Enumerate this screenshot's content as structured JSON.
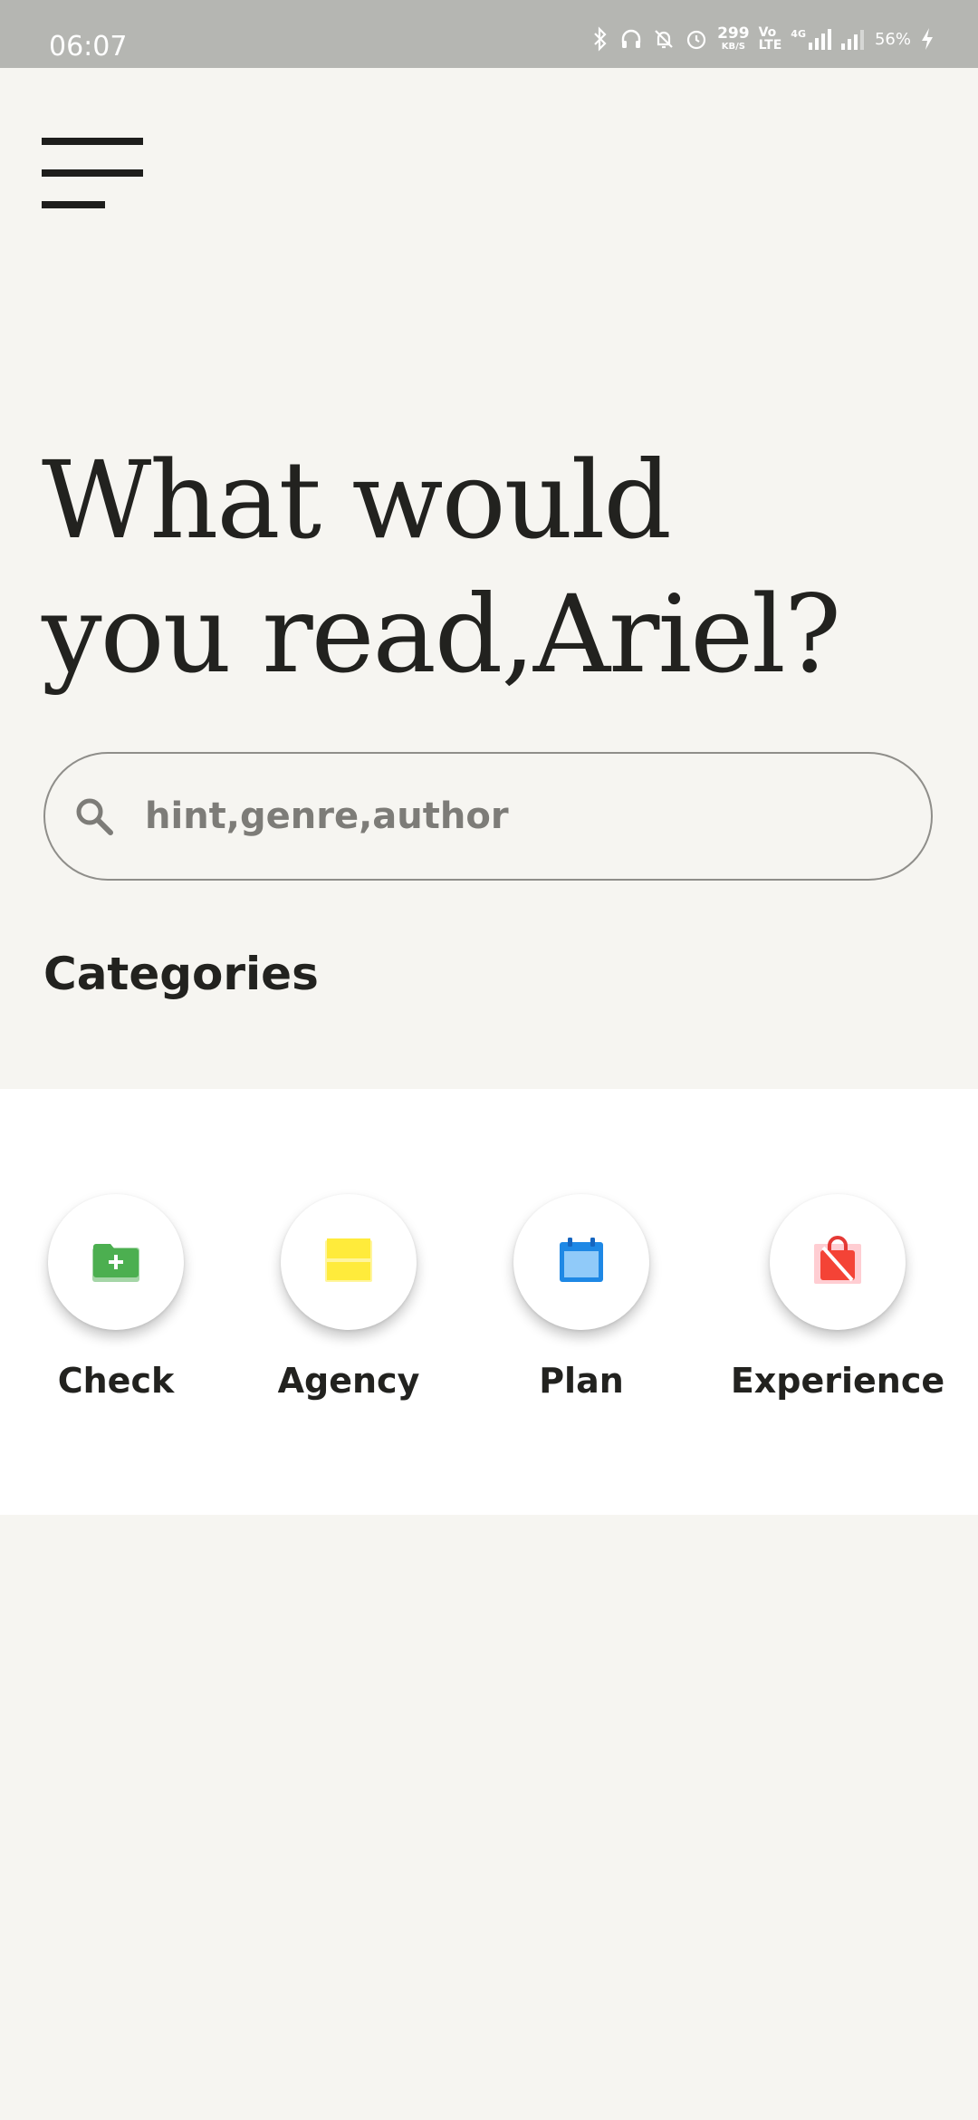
{
  "status_bar": {
    "time": "06:07",
    "net_speed_value": "299",
    "net_speed_unit": "KB/S",
    "volte_top": "Vo",
    "volte_bottom": "LTE",
    "network_type": "4G",
    "battery_percent": "56%"
  },
  "header": {
    "menu_icon": "hamburger-menu-icon",
    "headline_line1": "What would",
    "headline_line2": "you read,Ariel?"
  },
  "search": {
    "placeholder": "hint,genre,author",
    "icon": "search-icon"
  },
  "categories": {
    "title": "Categories",
    "items": [
      {
        "label": "Check",
        "icon": "folder-add-icon",
        "color": "#4caf50"
      },
      {
        "label": "Agency",
        "icon": "sticky-note-icon",
        "color": "#ffeb3b"
      },
      {
        "label": "Plan",
        "icon": "calendar-icon",
        "color": "#2196f3"
      },
      {
        "label": "Experience",
        "icon": "shopping-bag-off-icon",
        "color": "#f44336"
      }
    ]
  },
  "colors": {
    "background": "#f6f5f1",
    "status_bar": "#b5b6b2",
    "text_primary": "#22221f",
    "placeholder": "#7d7c78"
  }
}
